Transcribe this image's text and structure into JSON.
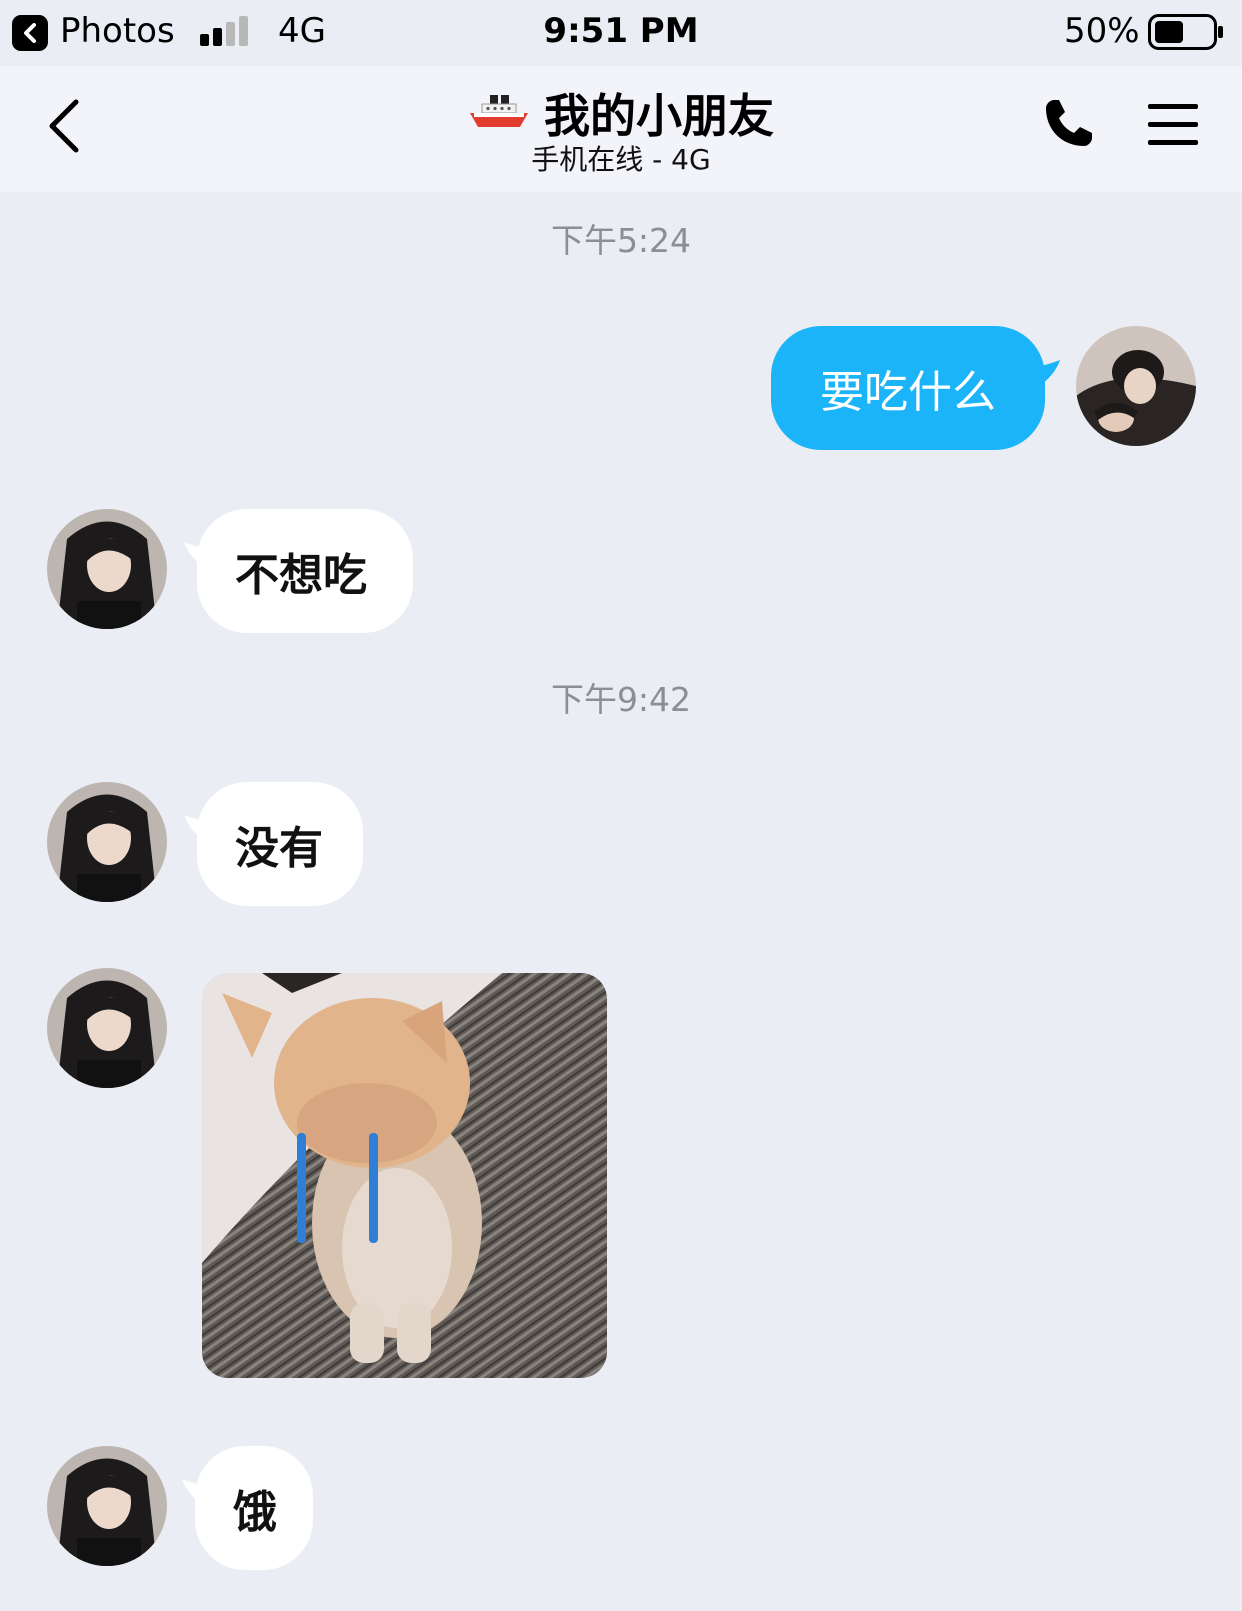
{
  "status_bar": {
    "back_app": "Photos",
    "network": "4G",
    "time": "9:51 PM",
    "battery_percent": "50%",
    "battery_level": 0.5,
    "signal_bars_active": 2
  },
  "header": {
    "title": "我的小朋友",
    "subtitle": "手机在线 - 4G",
    "title_icon": "ship-icon",
    "back_icon": "chevron-left-icon",
    "call_icon": "phone-icon",
    "menu_icon": "menu-icon"
  },
  "messages": {
    "timestamp_1": "下午5:24",
    "msg_1": "要吃什么",
    "msg_2": "不想吃",
    "timestamp_2": "下午9:42",
    "msg_3": "没有",
    "msg_5": "饿"
  },
  "colors": {
    "background": "#ebedf5",
    "outgoing_bubble": "#1cb4f9",
    "incoming_bubble": "#ffffff",
    "timestamp_text": "#8c8e94"
  }
}
